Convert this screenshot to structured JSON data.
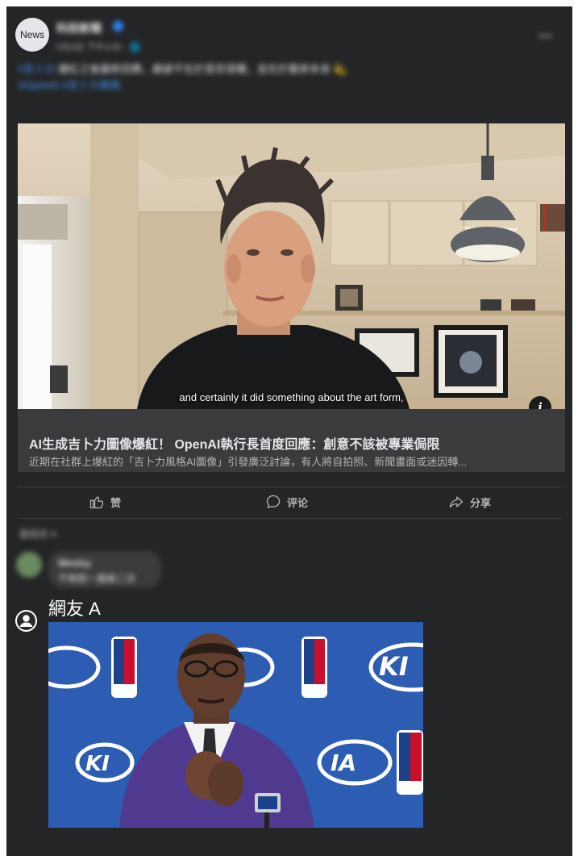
{
  "post": {
    "avatar_text": "News",
    "page_name": "科技新聞",
    "meta": "5月4日 下午3:45 · 🌐",
    "more": "•••",
    "text_tag": "#吉卜力",
    "text_body": " 爆紅之後最新回應，顧慮不在於是否侵權，並在於藝術本身 💫",
    "text_link": "#OpenAI #吉卜力風格"
  },
  "preview": {
    "caption": "and certainly it did something about the art form,",
    "info": "i",
    "title": "AI生成吉卜力圖像爆紅！ OpenAI執行長首度回應：創意不該被專業侷限",
    "description": "近期在社群上爆紅的「吉卜力風格AI圖像」引發廣泛討論，有人將自拍照、新聞畫面或迷因轉..."
  },
  "actions": {
    "like": "赞",
    "comment": "评论",
    "share": "分享"
  },
  "comments": {
    "sort": "最相关 ▾",
    "first_name": "Wesley",
    "first_text": "不爽就一直偷二次"
  },
  "reply": {
    "user_name": "網友 A"
  },
  "colors": {
    "card_bg": "#242526",
    "text_primary": "#e4e6eb",
    "text_secondary": "#b0b3b8",
    "link": "#4599ff"
  }
}
